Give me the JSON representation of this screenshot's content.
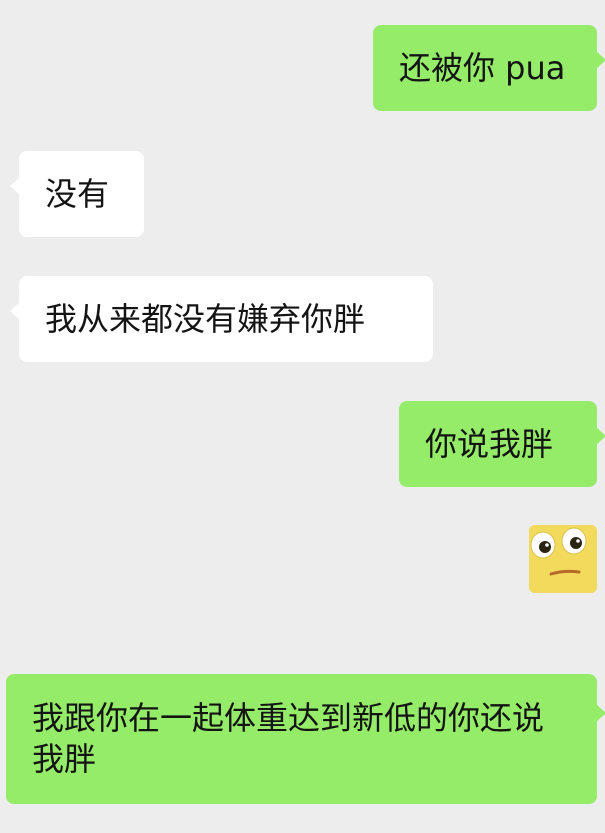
{
  "conversation": {
    "messages": [
      {
        "side": "sent",
        "text": "还被你 pua"
      },
      {
        "side": "received",
        "text": "没有"
      },
      {
        "side": "received",
        "text": "我从来都没有嫌弃你胖"
      },
      {
        "side": "sent",
        "text": "你说我胖"
      },
      {
        "side": "sent",
        "sticker": "wide-eyed-face-sticker"
      },
      {
        "side": "sent",
        "text": "我跟你在一起体重达到新低的你还说我胖"
      }
    ]
  },
  "colors": {
    "background": "#ededed",
    "sent_bubble": "#95ec69",
    "received_bubble": "#ffffff",
    "text": "#141414"
  }
}
